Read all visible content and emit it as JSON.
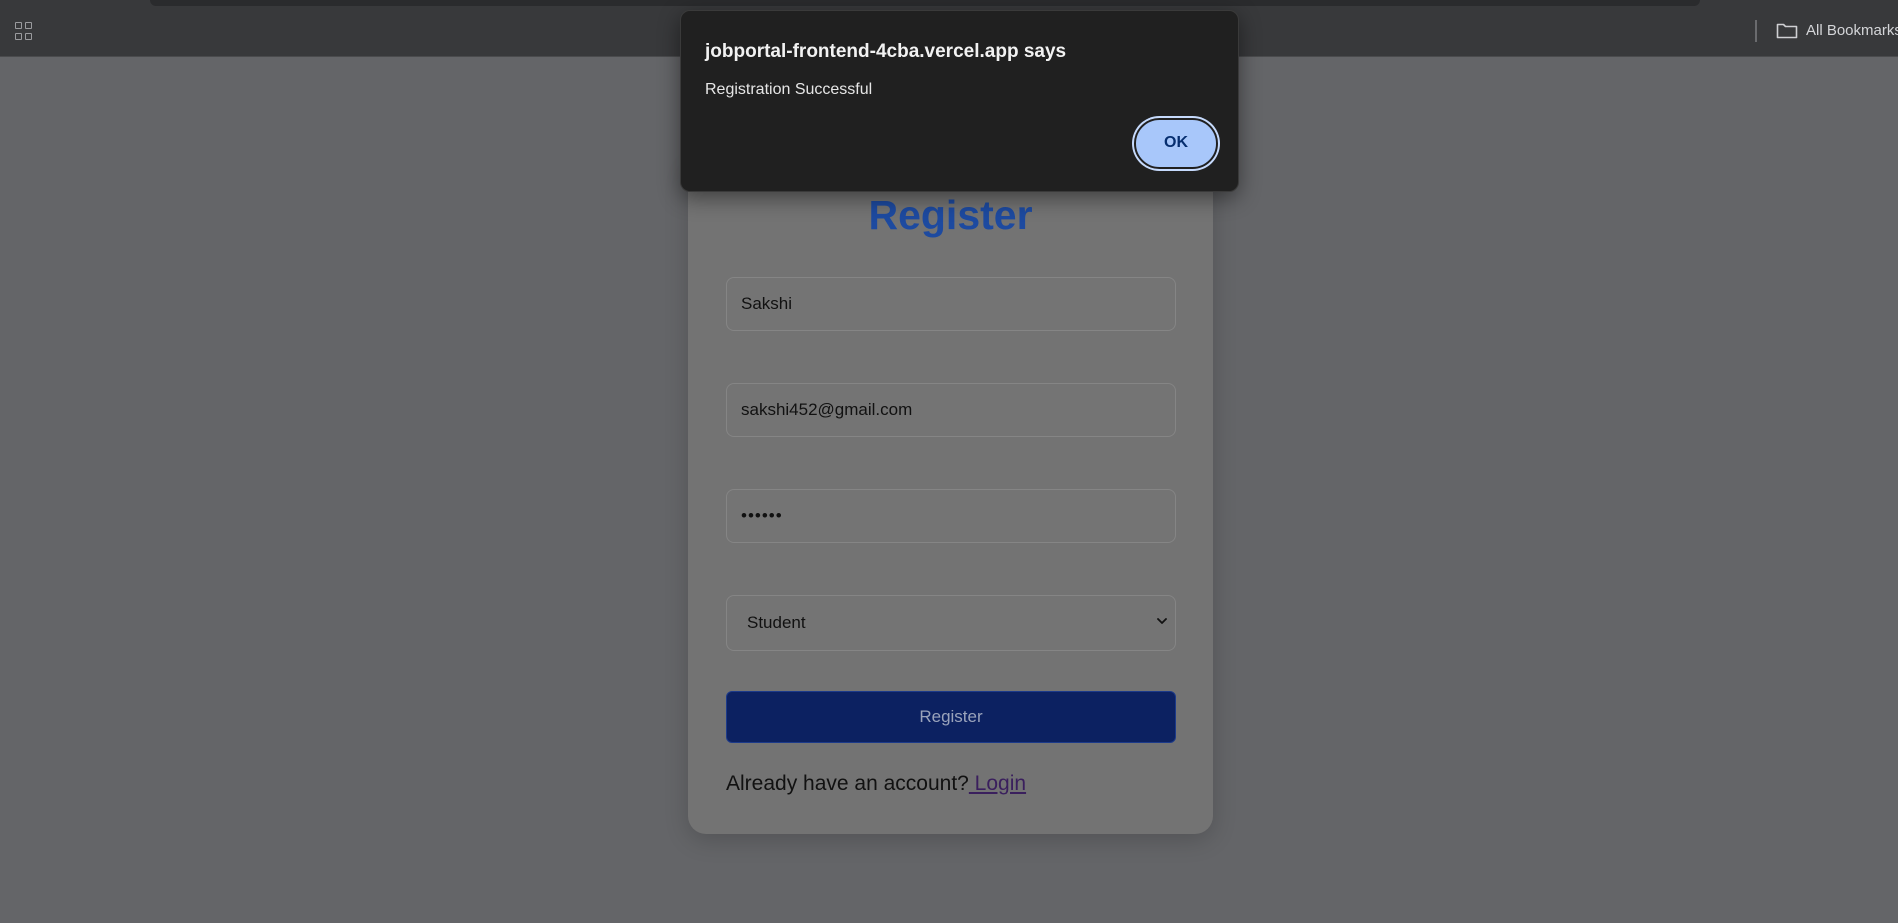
{
  "browser": {
    "bookmarks_label": "All Bookmarks"
  },
  "dialog": {
    "title": "jobportal-frontend-4cba.vercel.app says",
    "message": "Registration Successful",
    "ok_label": "OK"
  },
  "form": {
    "title": "Register",
    "name_value": "Sakshi",
    "email_value": "sakshi452@gmail.com",
    "password_masked": "••••••",
    "role_selected": "Student",
    "submit_label": "Register",
    "login_prompt": "Already have an account?",
    "login_link": " Login"
  },
  "colors": {
    "accent": "#1d4aa0",
    "button": "#0c2161",
    "dialog_button": "#a8c7fa"
  }
}
